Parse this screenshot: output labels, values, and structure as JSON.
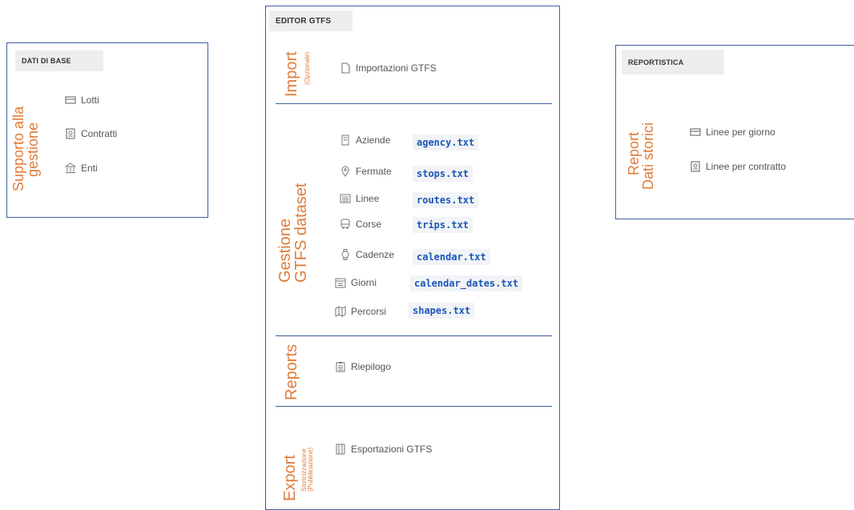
{
  "left_panel": {
    "header": "DATI DI BASE",
    "vertical_label": [
      "Supporto alla",
      "gestione"
    ],
    "items": [
      {
        "label": "Lotti",
        "icon": "card-icon"
      },
      {
        "label": "Contratti",
        "icon": "document-icon"
      },
      {
        "label": "Enti",
        "icon": "building-icon"
      }
    ]
  },
  "center_panel": {
    "header": "EDITOR GTFS",
    "sections": {
      "import": {
        "label": "Import",
        "sublabel": "(Opzionale)",
        "item": "Importazioni GTFS"
      },
      "gestione": {
        "label": [
          "Gestione",
          "GTFS dataset"
        ],
        "items": [
          {
            "label": "Aziende",
            "file": "agency.txt"
          },
          {
            "label": "Fermate",
            "file": "stops.txt"
          },
          {
            "label": "Linee",
            "file": "routes.txt"
          },
          {
            "label": "Corse",
            "file": "trips.txt"
          },
          {
            "label": "Cadenze",
            "file": "calendar.txt"
          },
          {
            "label": "Giorni",
            "file": "calendar_dates.txt"
          },
          {
            "label": "Percorsi",
            "file": "shapes.txt"
          }
        ]
      },
      "reports": {
        "label": "Reports",
        "item": "Riepilogo"
      },
      "export": {
        "label": "Export",
        "sublabel": [
          "Storicizzazione",
          "(Pubblicazione)"
        ],
        "item": "Esportazioni GTFS"
      }
    }
  },
  "right_panel": {
    "header": "REPORTISTICA",
    "vertical_label": [
      "Report",
      "Dati storici"
    ],
    "items": [
      {
        "label": "Linee per giorno",
        "icon": "card-icon"
      },
      {
        "label": "Linee per contratto",
        "icon": "document-icon"
      }
    ]
  },
  "colors": {
    "accent": "#e07b39",
    "border": "#3f5f9e",
    "code": "#1a56b8"
  }
}
